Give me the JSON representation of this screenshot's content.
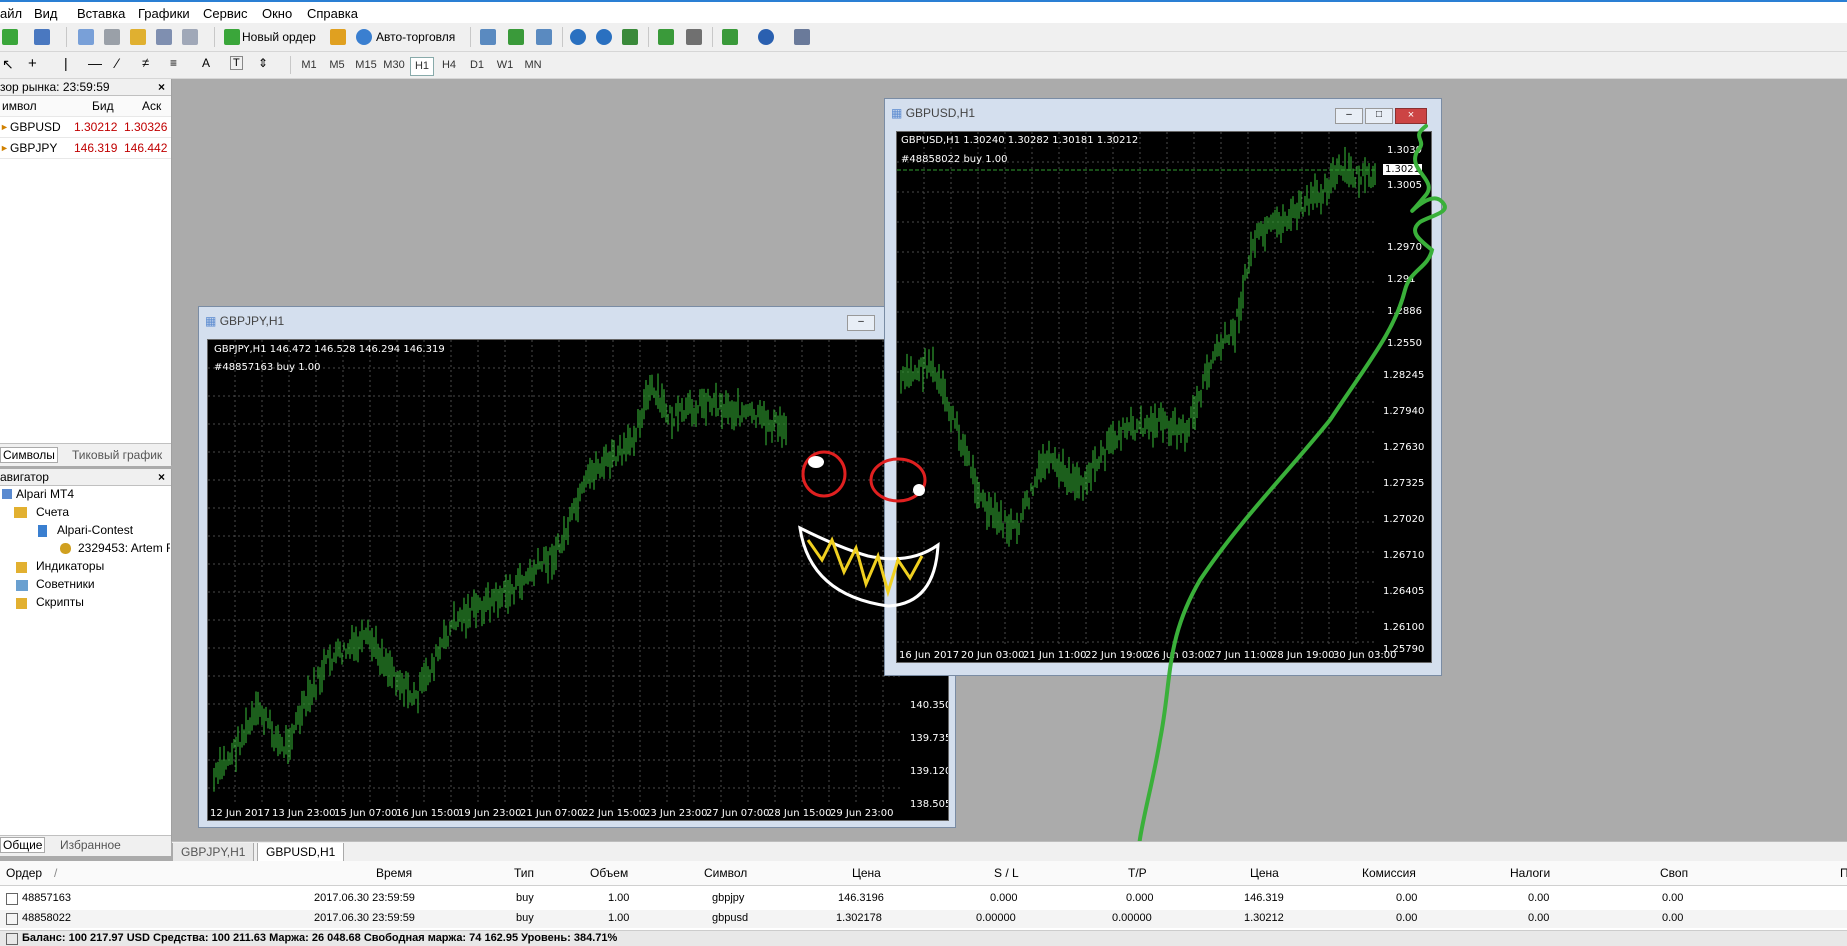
{
  "menu": [
    "айл",
    "Вид",
    "Вставка",
    "Графики",
    "Сервис",
    "Окно",
    "Справка"
  ],
  "toolbar": {
    "new_order": "Новый ордер",
    "auto_trading": "Авто-торговля"
  },
  "timeframes": [
    "M1",
    "M5",
    "M15",
    "M30",
    "H1",
    "H4",
    "D1",
    "W1",
    "MN"
  ],
  "market_watch": {
    "title": "зор рынка: 23:59:59",
    "headers": [
      "имвол",
      "Бид",
      "Аск"
    ],
    "rows": [
      {
        "symbol": "GBPUSD",
        "bid": "1.30212",
        "ask": "1.30326"
      },
      {
        "symbol": "GBPJPY",
        "bid": "146.319",
        "ask": "146.442"
      }
    ],
    "tabs": [
      "Символы",
      "Тиковый график"
    ]
  },
  "navigator": {
    "title": "авигатор",
    "items": [
      "Alpari MT4",
      "Счета",
      "Alpari-Contest",
      "2329453: Artem F",
      "Индикаторы",
      "Советники",
      "Скрипты"
    ],
    "tabs": [
      "Общие",
      "Избранное"
    ]
  },
  "chart_gbpjpy": {
    "window_title": "GBPJPY,H1",
    "header": "GBPJPY,H1  146.472 146.528 146.294 146.319",
    "order": "#48857163 buy 1.00",
    "prices": [
      "140.350",
      "139.735",
      "139.120",
      "138.505"
    ],
    "dates": [
      "12 Jun 2017",
      "13 Jun 23:00",
      "15 Jun 07:00",
      "16 Jun 15:00",
      "19 Jun 23:00",
      "21 Jun 07:00",
      "22 Jun 15:00",
      "23 Jun 23:00",
      "27 Jun 07:00",
      "28 Jun 15:00",
      "29 Jun 23:00"
    ]
  },
  "chart_gbpusd": {
    "window_title": "GBPUSD,H1",
    "header": "GBPUSD,H1  1.30240 1.30282 1.30181 1.30212",
    "order": "#48858022 buy 1.00",
    "price_marker": "1.3021",
    "prices": [
      "1.3039",
      "1.3005",
      "1.2970",
      "1.291",
      "1.2886",
      "1.2550",
      "1.28245",
      "1.27940",
      "1.27630",
      "1.27325",
      "1.27020",
      "1.26710",
      "1.26405",
      "1.26100",
      "1.25790"
    ],
    "dates": [
      "16 Jun 2017",
      "20 Jun 03:00",
      "21 Jun 11:00",
      "22 Jun 19:00",
      "26 Jun 03:00",
      "27 Jun 11:00",
      "28 Jun 19:00",
      "30 Jun 03:00"
    ]
  },
  "chart_tabs": [
    "GBPJPY,H1",
    "GBPUSD,H1"
  ],
  "terminal": {
    "headers": [
      "Ордер",
      "/",
      "Время",
      "Тип",
      "Объем",
      "Символ",
      "Цена",
      "S / L",
      "T/P",
      "Цена",
      "Комиссия",
      "Налоги",
      "Своп",
      "П"
    ],
    "rows": [
      [
        "48857163",
        "2017.06.30 23:59:59",
        "buy",
        "1.00",
        "gbpjpy",
        "146.3196",
        "0.000",
        "0.000",
        "146.319",
        "0.00",
        "0.00",
        "0.00"
      ],
      [
        "48858022",
        "2017.06.30 23:59:59",
        "buy",
        "1.00",
        "gbpusd",
        "1.302178",
        "0.00000",
        "0.00000",
        "1.30212",
        "0.00",
        "0.00",
        "0.00"
      ]
    ],
    "balance": "Баланс: 100 217.97 USD  Средства: 100 211.63  Маржа: 26 048.68  Свободная маржа: 74 162.95  Уровень: 384.71%"
  },
  "colors": {
    "bid_ask": "#c00000",
    "candle": "#2f9e2f",
    "chart_bg": "#000000",
    "grid": "#4a4a4a"
  }
}
